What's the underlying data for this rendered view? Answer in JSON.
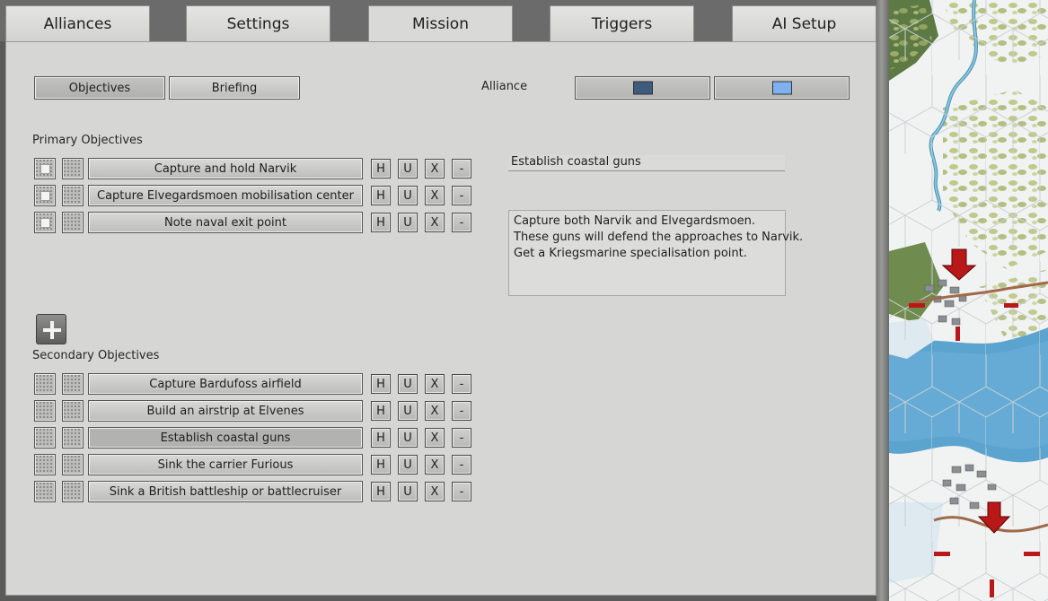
{
  "tabs": [
    {
      "label": "Alliances"
    },
    {
      "label": "Settings"
    },
    {
      "label": "Mission"
    },
    {
      "label": "Triggers"
    },
    {
      "label": "AI Setup"
    }
  ],
  "active_tab": "Mission",
  "subtabs": {
    "objectives": "Objectives",
    "briefing": "Briefing"
  },
  "alliance": {
    "label": "Alliance",
    "colors": [
      "#3e5a7c",
      "#7fb0f0"
    ]
  },
  "primary": {
    "heading": "Primary Objectives",
    "items": [
      {
        "label": "Capture and hold Narvik"
      },
      {
        "label": "Capture Elvegardsmoen mobilisation center"
      },
      {
        "label": "Note naval exit point"
      }
    ]
  },
  "secondary": {
    "heading": "Secondary Objectives",
    "items": [
      {
        "label": "Capture Bardufoss airfield"
      },
      {
        "label": "Build an airstrip at Elvenes"
      },
      {
        "label": "Establish coastal guns"
      },
      {
        "label": "Sink the carrier Furious"
      },
      {
        "label": "Sink a British battleship or battlecruiser"
      }
    ]
  },
  "row_buttons": {
    "h": "H",
    "u": "U",
    "x": "X",
    "minus": "-"
  },
  "add_icon": "plus-icon",
  "selected": {
    "title": "Establish coastal guns",
    "description": [
      "Capture both Narvik and Elvegardsmoen.",
      "These guns will defend the approaches to Narvik.",
      "Get a Kriegsmarine specialisation point."
    ]
  }
}
